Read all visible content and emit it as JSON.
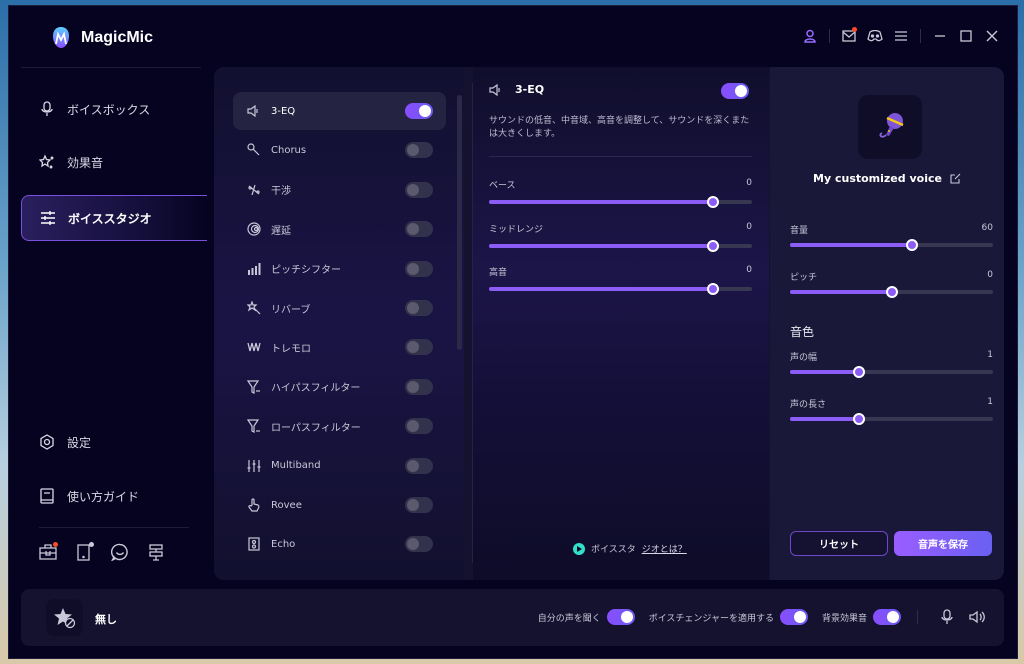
{
  "app": {
    "title": "MagicMic",
    "accent": "#8b5cf6",
    "top_icons": [
      "user-icon",
      "mail-icon",
      "discord-icon",
      "menu-icon",
      "minimize-icon",
      "maximize-icon",
      "close-icon"
    ]
  },
  "sidebar": {
    "items": [
      {
        "label": "ボイスボックス",
        "icon": "microphone-icon",
        "active": false
      },
      {
        "label": "効果音",
        "icon": "sparkle-icon",
        "active": false
      },
      {
        "label": "ボイススタジオ",
        "icon": "sliders-icon",
        "active": true
      }
    ],
    "bottom_items": [
      {
        "label": "設定",
        "icon": "settings-icon"
      },
      {
        "label": "使い方ガイド",
        "icon": "guide-book-icon"
      }
    ],
    "tools": [
      "toolbox-icon",
      "mobile-icon",
      "chat-icon",
      "signpost-icon"
    ]
  },
  "effects": [
    {
      "label": "3-EQ",
      "icon": "speaker-icon",
      "enabled": true,
      "selected": true
    },
    {
      "label": "Chorus",
      "icon": "mic-chorus-icon",
      "enabled": false
    },
    {
      "label": "干渉",
      "icon": "interference-icon",
      "enabled": false
    },
    {
      "label": "遅延",
      "icon": "delay-icon",
      "enabled": false
    },
    {
      "label": "ピッチシフター",
      "icon": "bars-icon",
      "enabled": false
    },
    {
      "label": "リバーブ",
      "icon": "reverb-wand-icon",
      "enabled": false
    },
    {
      "label": "トレモロ",
      "icon": "tremolo-wave-icon",
      "enabled": false
    },
    {
      "label": "ハイパスフィルター",
      "icon": "highpass-filter-icon",
      "enabled": false
    },
    {
      "label": "ローパスフィルター",
      "icon": "lowpass-filter-icon",
      "enabled": false
    },
    {
      "label": "Multiband",
      "icon": "multiband-icon",
      "enabled": false
    },
    {
      "label": "Rovee",
      "icon": "hand-icon",
      "enabled": false
    },
    {
      "label": "Echo",
      "icon": "echo-speaker-icon",
      "enabled": false
    }
  ],
  "eq": {
    "title": "3-EQ",
    "enabled": true,
    "description": "サウンドの低音、中音域、高音を調整して、サウンドを深くまたは大きくします。",
    "sliders": [
      {
        "label": "ベース",
        "value": "0",
        "fraction": 0.85
      },
      {
        "label": "ミッドレンジ",
        "value": "0",
        "fraction": 0.85
      },
      {
        "label": "高音",
        "value": "0",
        "fraction": 0.85
      }
    ],
    "help_prefix": "ボイススタ",
    "help_link": "ジオとは？"
  },
  "voice": {
    "name": "My customized voice",
    "sliders": [
      {
        "label": "音量",
        "value": "60",
        "fraction": 0.6
      },
      {
        "label": "ピッチ",
        "value": "0",
        "fraction": 0.5
      }
    ],
    "timbre_title": "音色",
    "timbre_sliders": [
      {
        "label": "声の幅",
        "value": "1",
        "fraction": 0.34
      },
      {
        "label": "声の長さ",
        "value": "1",
        "fraction": 0.34
      }
    ],
    "reset_label": "リセット",
    "save_label": "音声を保存"
  },
  "bottom": {
    "current_effect": "無し",
    "controls": [
      {
        "label": "自分の声を聞く",
        "enabled": true
      },
      {
        "label": "ボイスチェンジャーを適用する",
        "enabled": true
      },
      {
        "label": "背景効果音",
        "enabled": true
      }
    ]
  }
}
